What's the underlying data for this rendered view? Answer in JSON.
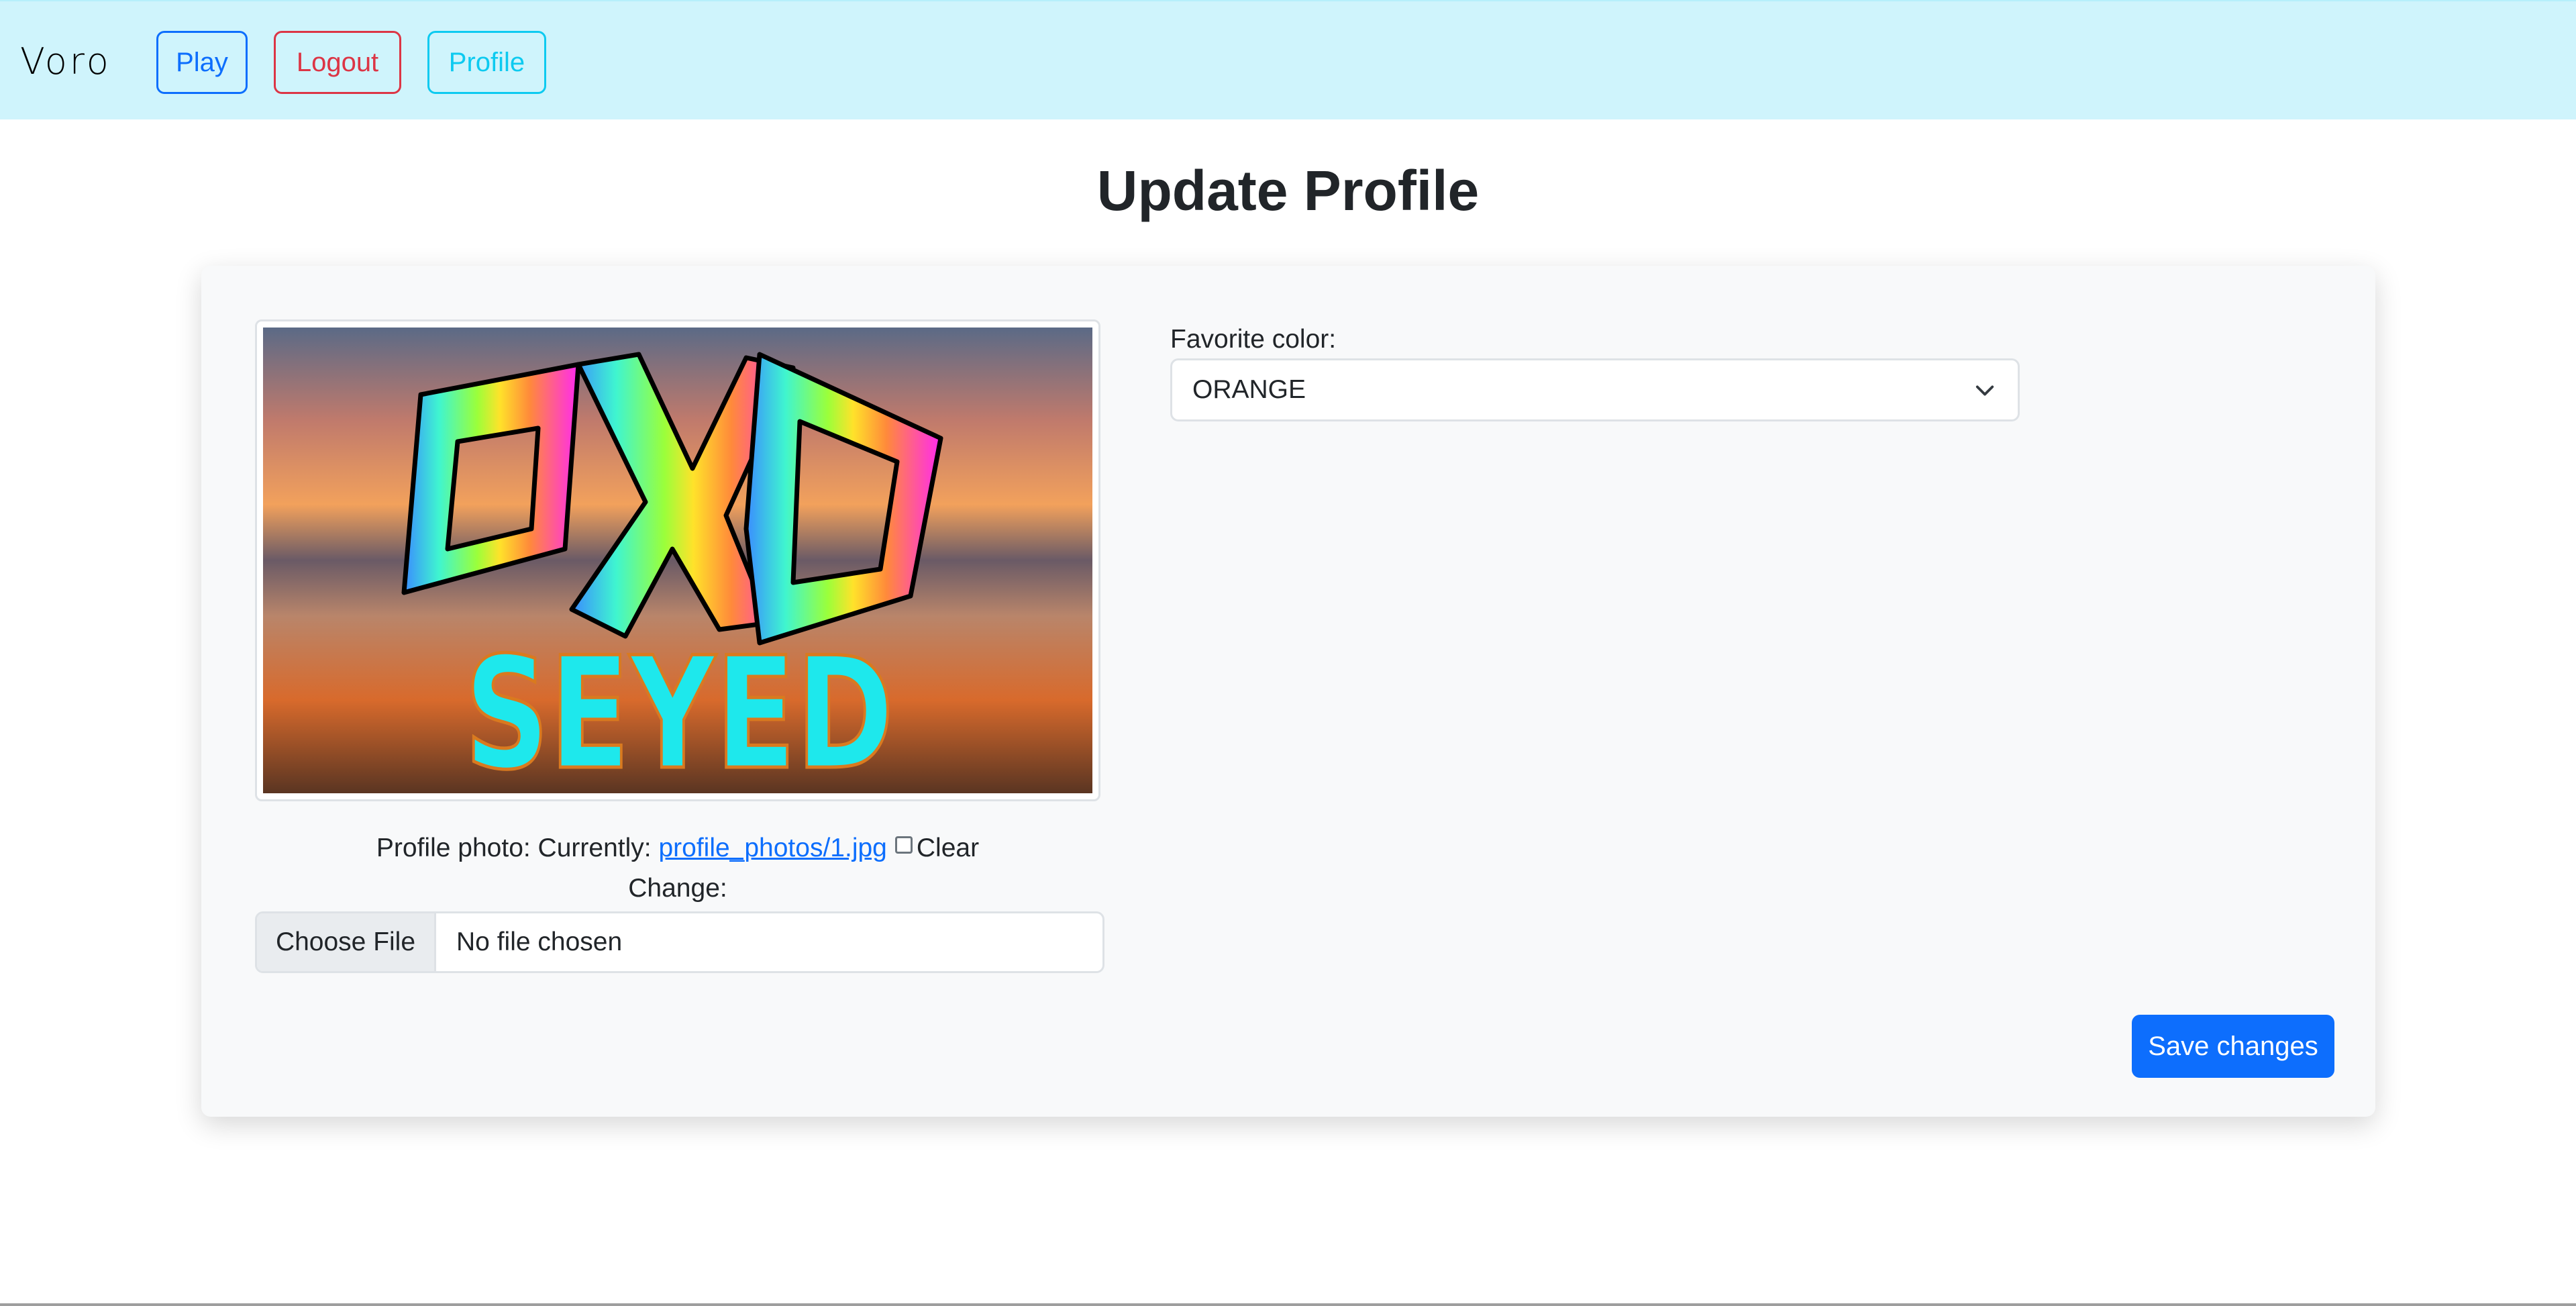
{
  "navbar": {
    "brand": "Voro",
    "buttons": [
      {
        "label": "Play",
        "color": "#0d6efd"
      },
      {
        "label": "Logout",
        "color": "#dc3545"
      },
      {
        "label": "Profile",
        "color": "#0dcaf0"
      }
    ],
    "background": "#cff4fc"
  },
  "page": {
    "title": "Update Profile"
  },
  "profile_photo": {
    "label": "Profile photo: Currently:",
    "current_file": "profile_photos/1.jpg",
    "clear_label": "Clear",
    "clear_checked": false,
    "change_label": "Change:",
    "image_text": "SEYED"
  },
  "file_input": {
    "button_label": "Choose File",
    "status": "No file chosen"
  },
  "favorite_color": {
    "label": "Favorite color:",
    "selected": "ORANGE"
  },
  "actions": {
    "save_label": "Save changes",
    "accent": "#0d6efd"
  }
}
